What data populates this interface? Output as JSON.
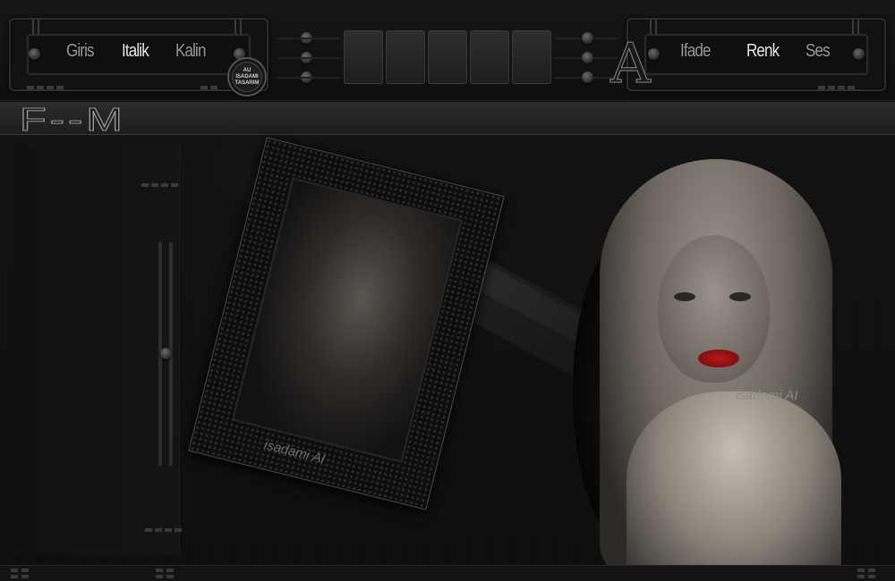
{
  "left_menu": {
    "items": [
      {
        "label": "Giris"
      },
      {
        "label": "Italik"
      },
      {
        "label": "Kalin"
      }
    ]
  },
  "right_menu": {
    "items": [
      {
        "label": "Ifade"
      },
      {
        "label": "Renk"
      },
      {
        "label": "Ses"
      }
    ]
  },
  "logo": {
    "line1": "AU",
    "line2": "ISADAMI",
    "line3": "TASARIM"
  },
  "decor_letter": "A",
  "title": "F--M",
  "watermark": {
    "frame": "isadami AI",
    "portrait": "isadami AI"
  },
  "colors": {
    "background": "#0b0b0b",
    "panel": "#121212",
    "text_dim": "#9a9a9a",
    "text_bright": "#e8e8e8",
    "lip_red": "#b51818"
  },
  "icons": [
    "knob-icon",
    "tile-button",
    "logo-badge"
  ]
}
